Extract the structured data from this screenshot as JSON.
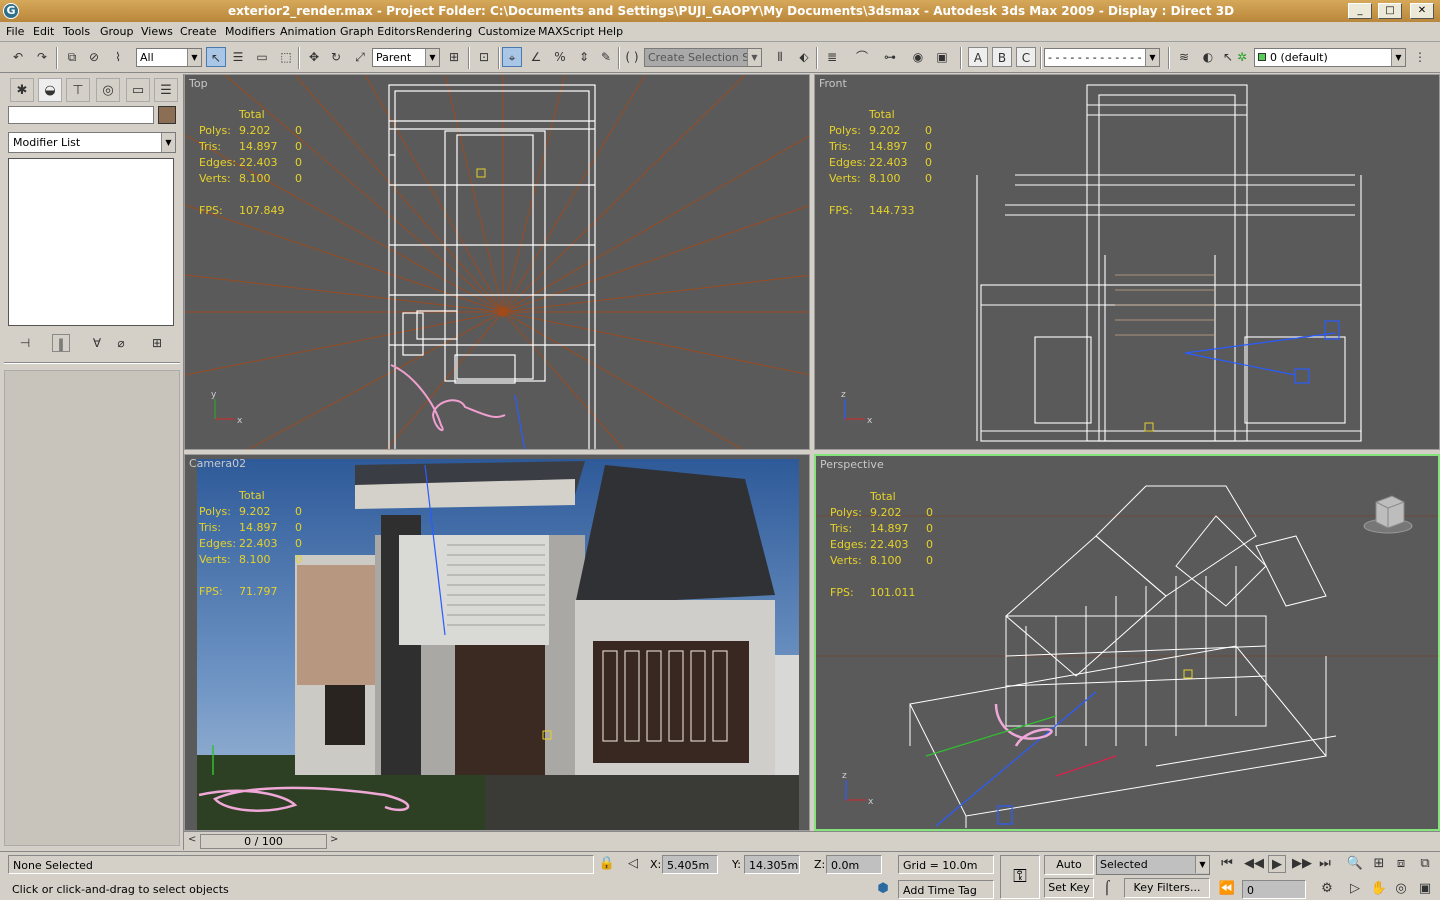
{
  "window": {
    "title": "exterior2_render.max     - Project Folder: C:\\Documents and Settings\\PUJI_GAOPY\\My Documents\\3dsmax     - Autodesk 3ds Max  2009     - Display : Direct 3D",
    "minimize": "_",
    "maximize": "□",
    "close": "✕"
  },
  "menu": [
    "File",
    "Edit",
    "Tools",
    "Group",
    "Views",
    "Create",
    "Modifiers",
    "Animation",
    "Graph Editors",
    "Rendering",
    "Customize",
    "MAXScript",
    "Help"
  ],
  "toolbar": {
    "selection_filter": "All",
    "reference_coord": "Parent",
    "named_selection_placeholder": "Create Selection Se",
    "abc": [
      "A",
      "B",
      "C"
    ],
    "layer_combo": "",
    "layer": "0 (default)"
  },
  "command_panel": {
    "modifier_list": "Modifier List"
  },
  "viewports": [
    {
      "id": "top",
      "label": "Top",
      "stats": {
        "total": "Total",
        "polys": [
          "Polys:",
          "9.202",
          "0"
        ],
        "tris": [
          "Tris:",
          "14.897",
          "0"
        ],
        "edges": [
          "Edges:",
          "22.403",
          "0"
        ],
        "verts": [
          "Verts:",
          "8.100",
          "0"
        ],
        "fps": [
          "FPS:",
          "107.849"
        ]
      }
    },
    {
      "id": "front",
      "label": "Front",
      "stats": {
        "total": "Total",
        "polys": [
          "Polys:",
          "9.202",
          "0"
        ],
        "tris": [
          "Tris:",
          "14.897",
          "0"
        ],
        "edges": [
          "Edges:",
          "22.403",
          "0"
        ],
        "verts": [
          "Verts:",
          "8.100",
          "0"
        ],
        "fps": [
          "FPS:",
          "144.733"
        ]
      }
    },
    {
      "id": "camera",
      "label": "Camera02",
      "stats": {
        "total": "Total",
        "polys": [
          "Polys:",
          "9.202",
          "0"
        ],
        "tris": [
          "Tris:",
          "14.897",
          "0"
        ],
        "edges": [
          "Edges:",
          "22.403",
          "0"
        ],
        "verts": [
          "Verts:",
          "8.100",
          "0"
        ],
        "fps": [
          "FPS:",
          "71.797"
        ]
      }
    },
    {
      "id": "perspective",
      "label": "Perspective",
      "stats": {
        "total": "Total",
        "polys": [
          "Polys:",
          "9.202",
          "0"
        ],
        "tris": [
          "Tris:",
          "14.897",
          "0"
        ],
        "edges": [
          "Edges:",
          "22.403",
          "0"
        ],
        "verts": [
          "Verts:",
          "8.100",
          "0"
        ],
        "fps": [
          "FPS:",
          "101.011"
        ]
      }
    }
  ],
  "timeslider": {
    "frame": "0 / 100",
    "prev": "<",
    "next": ">"
  },
  "status": {
    "selection": "None Selected",
    "prompt": "Click or click-and-drag to select objects",
    "x_label": "X:",
    "x_value": "5.405m",
    "y_label": "Y:",
    "y_value": "14.305m",
    "z_label": "Z:",
    "z_value": "0.0m",
    "grid": "Grid = 10.0m",
    "add_time_tag": "Add Time Tag",
    "auto_key": "Auto Key",
    "set_key": "Set Key",
    "key_mode": "Selected",
    "key_filters": "Key Filters...",
    "current_frame": "0"
  },
  "colors": {
    "viewport_bg": "#5a5a5a",
    "stats_text": "#e6d22a",
    "active_border": "#84e37a",
    "wire": "#ffffff"
  }
}
